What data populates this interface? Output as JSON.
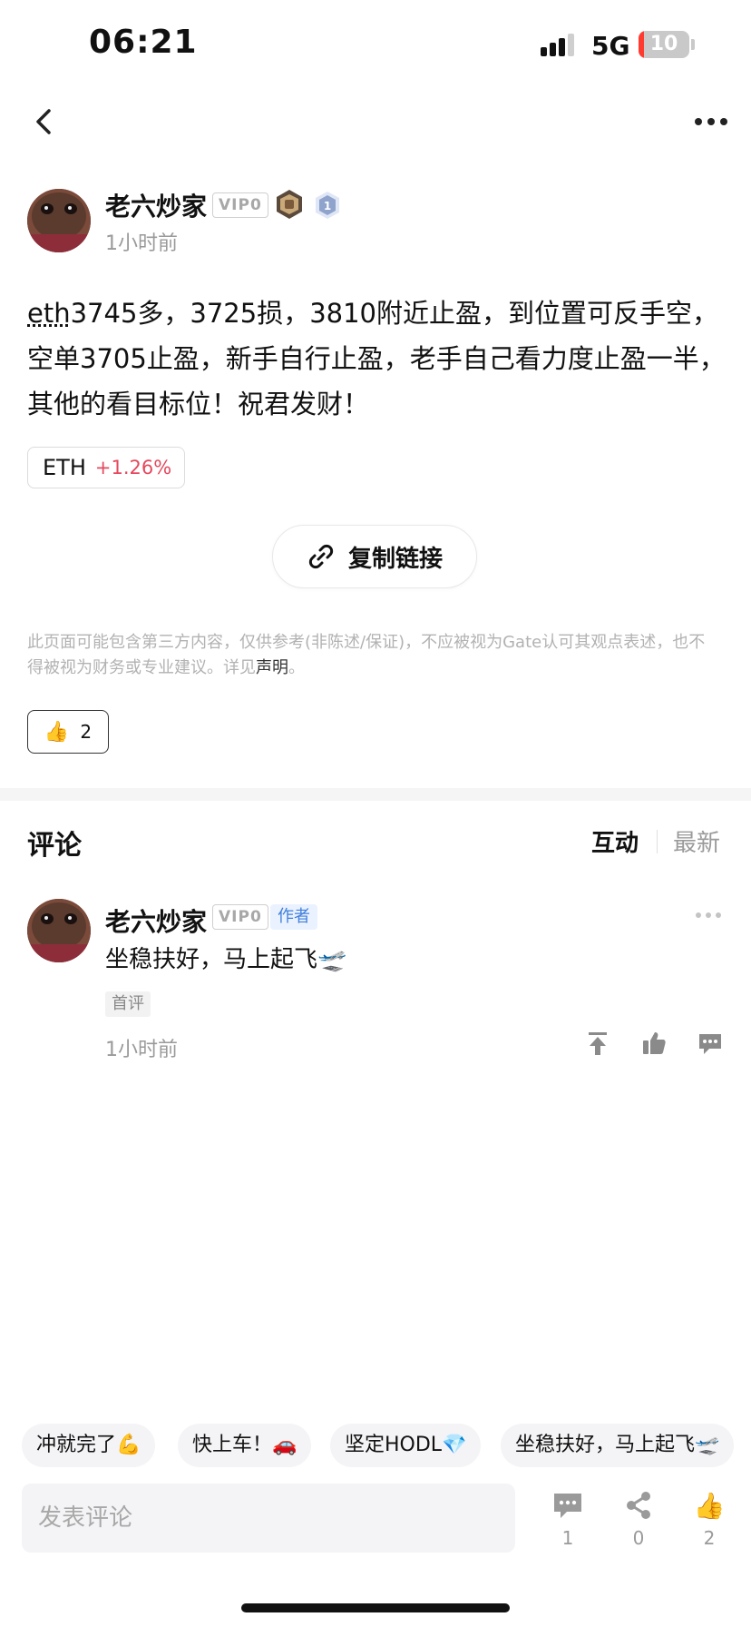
{
  "status_bar": {
    "time": "06:21",
    "network": "5G",
    "battery_level": "10",
    "battery_fraction": 0.1,
    "battery_color": "#ff3b30"
  },
  "nav": {
    "back_icon": "chevron-left-icon",
    "more_icon": "more-horizontal-icon"
  },
  "post": {
    "author": {
      "name": "老六炒家",
      "vip": "VIP0",
      "medal_icon": "badge-medal-icon",
      "level": "1"
    },
    "time": "1小时前",
    "content": {
      "tag": "eth",
      "text": "3745多，3725损，3810附近止盈，到位置可反手空，空单3705止盈，新手自行止盈，老手自己看力度止盈一半，其他的看目标位！祝君发财！"
    },
    "coin": {
      "symbol": "ETH",
      "change": "+1.26%",
      "change_color": "#e5485d"
    },
    "copy_link_label": "复制链接",
    "disclaimer": {
      "text": "此页面可能包含第三方内容，仅供参考(非陈述/保证)，不应被视为Gate认可其观点表述，也不得被视为财务或专业建议。详见",
      "link": "声明",
      "end": "。"
    },
    "likes": {
      "emoji": "👍",
      "count": "2"
    }
  },
  "comments": {
    "title": "评论",
    "sort": {
      "active": "互动",
      "other": "最新"
    },
    "items": [
      {
        "author": "老六炒家",
        "vip": "VIP0",
        "author_badge": "作者",
        "text": "坐稳扶好，马上起飞🛫",
        "first_badge": "首评",
        "time": "1小时前"
      }
    ]
  },
  "quick_replies": [
    "冲就完了💪",
    "快上车！🚗",
    "坚定HODL💎",
    "坐稳扶好，马上起飞🛫"
  ],
  "bottom_bar": {
    "input_placeholder": "发表评论",
    "comment_count": "1",
    "share_count": "0",
    "like_count": "2",
    "like_emoji": "👍"
  },
  "colors": {
    "accent_blue": "#3f7fdb",
    "up_red": "#e5485d"
  }
}
